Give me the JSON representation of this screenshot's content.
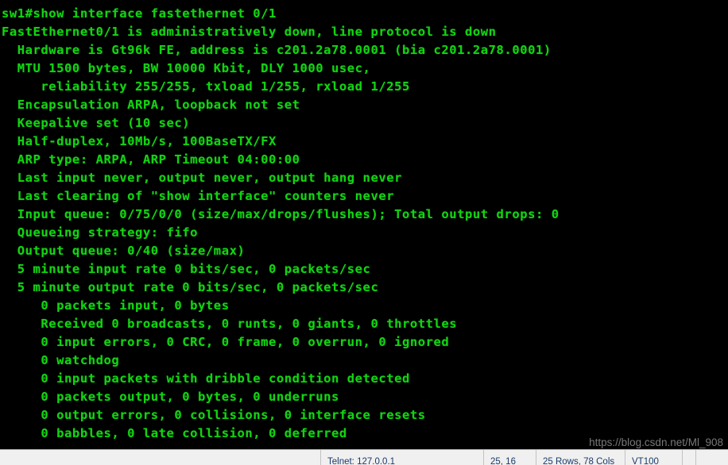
{
  "terminal": {
    "prompt_line": "sw1#show interface fastethernet 0/1",
    "lines": [
      "sw1#show interface fastethernet 0/1",
      "FastEthernet0/1 is administratively down, line protocol is down",
      "  Hardware is Gt96k FE, address is c201.2a78.0001 (bia c201.2a78.0001)",
      "  MTU 1500 bytes, BW 10000 Kbit, DLY 1000 usec,",
      "     reliability 255/255, txload 1/255, rxload 1/255",
      "  Encapsulation ARPA, loopback not set",
      "  Keepalive set (10 sec)",
      "  Half-duplex, 10Mb/s, 100BaseTX/FX",
      "  ARP type: ARPA, ARP Timeout 04:00:00",
      "  Last input never, output never, output hang never",
      "  Last clearing of \"show interface\" counters never",
      "  Input queue: 0/75/0/0 (size/max/drops/flushes); Total output drops: 0",
      "  Queueing strategy: fifo",
      "  Output queue: 0/40 (size/max)",
      "  5 minute input rate 0 bits/sec, 0 packets/sec",
      "  5 minute output rate 0 bits/sec, 0 packets/sec",
      "     0 packets input, 0 bytes",
      "     Received 0 broadcasts, 0 runts, 0 giants, 0 throttles",
      "     0 input errors, 0 CRC, 0 frame, 0 overrun, 0 ignored",
      "     0 watchdog",
      "     0 input packets with dribble condition detected",
      "     0 packets output, 0 bytes, 0 underruns",
      "     0 output errors, 0 collisions, 0 interface resets",
      "     0 babbles, 0 late collision, 0 deferred"
    ],
    "foreground_color": "#12d312",
    "background_color": "#000000"
  },
  "watermark": {
    "text": "https://blog.csdn.net/Ml_908",
    "color": "#8d8d8d"
  },
  "status_bar": {
    "connected": "",
    "telnet": "Telnet: 127.0.0.1",
    "cursor": "25, 16",
    "dimensions": "25 Rows, 78 Cols",
    "emulation": "VT100",
    "spacer": "",
    "trailing": ""
  }
}
